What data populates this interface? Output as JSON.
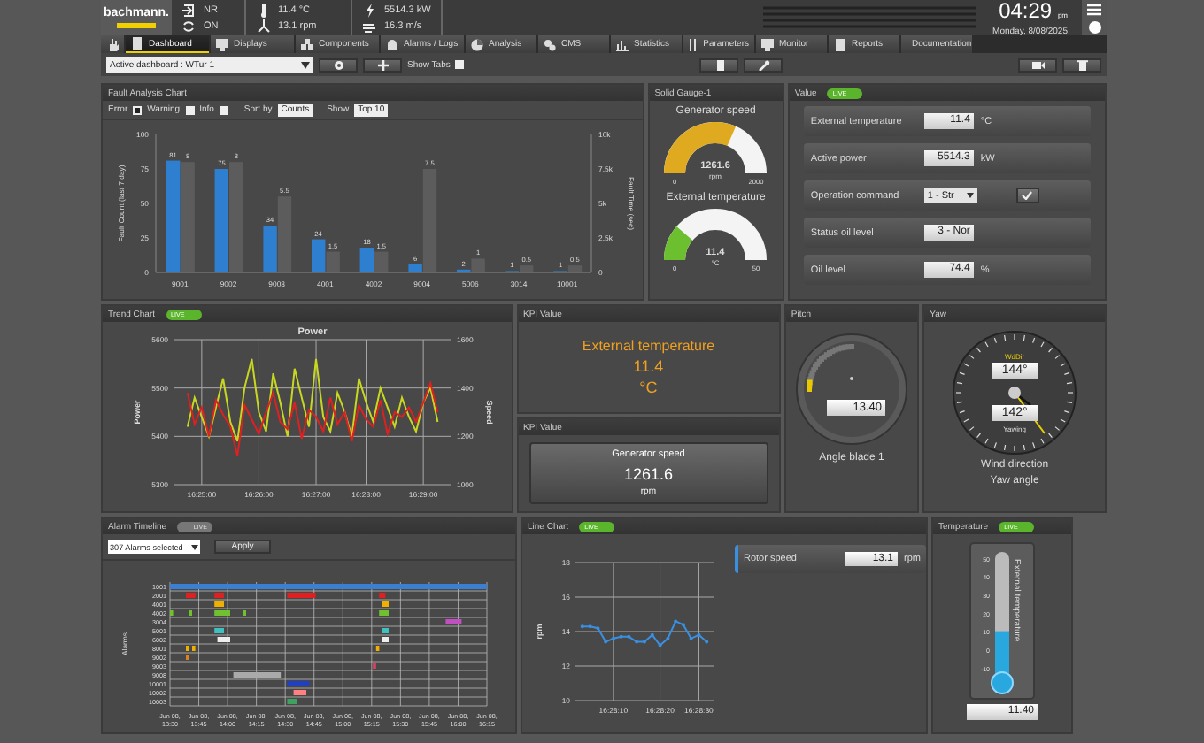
{
  "header": {
    "logo": "bachmann.",
    "status": [
      {
        "items": [
          "NR",
          "ON"
        ]
      },
      {
        "items": [
          "11.4 °C",
          "13.1 rpm"
        ]
      },
      {
        "items": [
          "5514.3 kW",
          "16.3 m/s"
        ]
      }
    ],
    "clock": {
      "time": "04:29",
      "ampm": "pm",
      "date": "Monday, 8/08/2025"
    }
  },
  "nav_tabs": [
    {
      "label": "Dashboard",
      "selected": true
    },
    {
      "label": "Displays",
      "selected": false
    },
    {
      "label": "Components",
      "selected": false
    },
    {
      "label": "Alarms / Logs",
      "selected": false
    },
    {
      "label": "Analysis",
      "selected": false
    },
    {
      "label": "CMS",
      "selected": false
    },
    {
      "label": "Statistics",
      "selected": false
    },
    {
      "label": "Parameters",
      "selected": false
    },
    {
      "label": "Monitor",
      "selected": false
    },
    {
      "label": "Reports",
      "selected": false
    },
    {
      "label": "Documentation",
      "selected": false
    }
  ],
  "toolbar": {
    "dashboard_select": "Active dashboard : WTur 1",
    "show_tabs": {
      "label": "Show Tabs",
      "checked": false
    }
  },
  "rows": [
    [
      {
        "kind": "fault",
        "title": "Fault Analysis Chart",
        "filters": [
          {
            "label": "Error",
            "checked": true
          },
          {
            "label": "Warning",
            "checked": false
          },
          {
            "label": "Info",
            "checked": false
          }
        ],
        "sort_label": "Sort by",
        "sort_value": "Counts",
        "show_label": "Show",
        "show_value": "Top 10",
        "chart_data": {
          "type": "bar",
          "ylabel": "Fault Count (last 7 day)",
          "y2label": "Fault Time (sec)",
          "categories": [
            "9001",
            "9002",
            "9003",
            "4001",
            "4002",
            "9004",
            "5006",
            "3014",
            "10001"
          ],
          "stacked": false,
          "ylim": [
            0,
            100
          ],
          "yticks": [
            0,
            25,
            50,
            75,
            100
          ],
          "y2lim": [
            0,
            10
          ],
          "y2ticks": [
            {
              "value": 0,
              "label": "0"
            },
            {
              "value": 2.5,
              "label": "2.5k"
            },
            {
              "value": 5,
              "label": "5k"
            },
            {
              "value": 7.5,
              "label": "7.5k"
            },
            {
              "value": 10,
              "label": "10k"
            }
          ],
          "series": [
            {
              "color": "#2f7fd0",
              "values": [
                81,
                75,
                34,
                24,
                18,
                6,
                2,
                1,
                1
              ]
            },
            {
              "color": "#5c5c5c",
              "axis": "y2",
              "values": [
                8,
                8,
                5.5,
                1.5,
                1.5,
                7.5,
                1,
                0.5,
                0.5
              ]
            }
          ],
          "data_labels": true
        }
      },
      {
        "kind": "gauges",
        "title": "Solid Gauge-1",
        "gauges": [
          {
            "label": "Generator speed",
            "value": "1261.6",
            "unit": "rpm",
            "min": "0",
            "max": "2000",
            "color": "#e0aa20"
          },
          {
            "label": "External temperature",
            "value": "11.4",
            "unit": "°C",
            "min": "0",
            "max": "50",
            "color": "#6cbf2e"
          }
        ]
      },
      {
        "kind": "values",
        "title": "Value",
        "toggle": {
          "label": "LIVE",
          "on": true
        },
        "items": [
          {
            "kind": "field",
            "label": "External temperature",
            "value": "11.4",
            "unit": "°C"
          },
          {
            "kind": "field",
            "label": "Active power",
            "value": "5514.3",
            "unit": "kW"
          },
          {
            "kind": "select",
            "label": "Operation command",
            "value": "1 - Str"
          },
          {
            "kind": "field",
            "label": "Status oil level",
            "value": "3 - Nor"
          },
          {
            "kind": "field",
            "label": "Oil level",
            "value": "74.4",
            "unit": "%"
          }
        ]
      }
    ],
    [
      {
        "kind": "trend",
        "title": "Trend Chart",
        "toggle": {
          "label": "LIVE",
          "on": true
        },
        "chart_data": {
          "type": "line",
          "title": "Power",
          "ylabel": "Power",
          "y2label": "Speed",
          "grid": true,
          "categories": [
            null,
            null,
            "16:25:00",
            null,
            null,
            null,
            null,
            null,
            null,
            null,
            "16:26:00",
            null,
            null,
            null,
            null,
            null,
            null,
            null,
            "16:27:00",
            null,
            null,
            null,
            null,
            null,
            null,
            "16:28:00",
            null,
            null,
            null,
            null,
            null,
            null,
            null,
            "16:29:00",
            null,
            null
          ],
          "ylim": [
            5300,
            5600
          ],
          "yticks": [
            5300,
            5400,
            5500,
            5600
          ],
          "y2lim": [
            1000,
            1600
          ],
          "y2ticks": [
            1000,
            1200,
            1400,
            1600
          ],
          "series": [
            {
              "color": "#c8d820",
              "values": [
                5420,
                5480,
                5440,
                5400,
                5460,
                5520,
                5430,
                5390,
                5500,
                5560,
                5450,
                5410,
                5530,
                5470,
                5400,
                5540,
                5480,
                5420,
                5560,
                5440,
                5410,
                5490,
                5450,
                5400,
                5520,
                5470,
                5430,
                5500,
                5460,
                5420,
                5480,
                5440,
                5410,
                5470,
                5500,
                5430
              ]
            },
            {
              "color": "#e02020",
              "axis": "y2",
              "values": [
                1380,
                1250,
                1320,
                1200,
                1350,
                1290,
                1240,
                1120,
                1330,
                1270,
                1210,
                1300,
                1380,
                1260,
                1230,
                1340,
                1190,
                1310,
                1280,
                1220,
                1360,
                1250,
                1300,
                1180,
                1330,
                1270,
                1240,
                1350,
                1210,
                1300,
                1280,
                1320,
                1260,
                1340,
                1420,
                1300
              ]
            }
          ]
        }
      },
      {
        "kind": "stack",
        "panels": [
          {
            "kind": "kpi_text",
            "title": "KPI Value",
            "label": "External temperature",
            "value": "11.4",
            "unit": "°C"
          },
          {
            "kind": "kpi_card",
            "title": "KPI Value",
            "label": "Generator speed",
            "value": "1261.6",
            "unit": "rpm"
          }
        ]
      },
      {
        "kind": "pitch",
        "title": "Pitch",
        "value": "13.40",
        "label": "Angle blade 1",
        "level": 0.13
      },
      {
        "kind": "yaw",
        "title": "Yaw",
        "top_label": "WdDir",
        "top_value": "144°",
        "bottom_value": "142°",
        "bottom_label": "Yawing",
        "captions": [
          "Wind direction",
          "Yaw angle"
        ]
      }
    ],
    [
      {
        "kind": "alarms",
        "title": "Alarm Timeline",
        "toggle": {
          "label": "LIVE",
          "on": false
        },
        "select": "307 Alarms selected",
        "button": "Apply",
        "ylabel": "Alarms",
        "rows": [
          "1001",
          "2001",
          "4001",
          "4002",
          "3004",
          "5001",
          "6002",
          "8001",
          "9002",
          "9003",
          "9008",
          "10001",
          "10002",
          "10003"
        ],
        "times": [
          {
            "date": "Jun 08,",
            "time": "13:30"
          },
          {
            "date": "Jun 08,",
            "time": "13:45"
          },
          {
            "date": "Jun 08,",
            "time": "14:00"
          },
          {
            "date": "Jun 08,",
            "time": "14:15"
          },
          {
            "date": "Jun 08,",
            "time": "14:30"
          },
          {
            "date": "Jun 08,",
            "time": "14:45"
          },
          {
            "date": "Jun 08,",
            "time": "15:00"
          },
          {
            "date": "Jun 08,",
            "time": "15:15"
          },
          {
            "date": "Jun 08,",
            "time": "15:30"
          },
          {
            "date": "Jun 08,",
            "time": "15:45"
          },
          {
            "date": "Jun 08,",
            "time": "16:00"
          },
          {
            "date": "Jun 08,",
            "time": "16:15"
          }
        ]
      },
      {
        "kind": "line",
        "title": "Line Chart",
        "toggle": {
          "label": "LIVE",
          "on": true
        },
        "field": {
          "label": "Rotor speed",
          "value": "13.1",
          "unit": "rpm"
        },
        "chart_data": {
          "type": "line",
          "ylabel": "rpm",
          "grid": true,
          "categories": [
            null,
            null,
            null,
            null,
            "16:28:10",
            null,
            null,
            null,
            null,
            null,
            "16:28:20",
            null,
            null,
            null,
            null,
            "16:28:30",
            null
          ],
          "ylim": [
            10,
            18
          ],
          "yticks": [
            10,
            12,
            14,
            16,
            18
          ],
          "series": [
            {
              "color": "#3a8fe0",
              "values": [
                14.3,
                14.3,
                14.2,
                13.4,
                13.6,
                13.7,
                13.7,
                13.4,
                13.4,
                13.8,
                13.2,
                13.6,
                14.6,
                14.4,
                13.6,
                13.8,
                13.4
              ]
            }
          ]
        }
      },
      {
        "kind": "thermo",
        "title": "Temperature",
        "toggle": {
          "label": "LIVE",
          "on": true
        },
        "label": "External temperature",
        "value": "11.40",
        "ticks": [
          "50",
          "40",
          "30",
          "20",
          "10",
          "0",
          "-10"
        ],
        "level": 0.36
      }
    ]
  ]
}
